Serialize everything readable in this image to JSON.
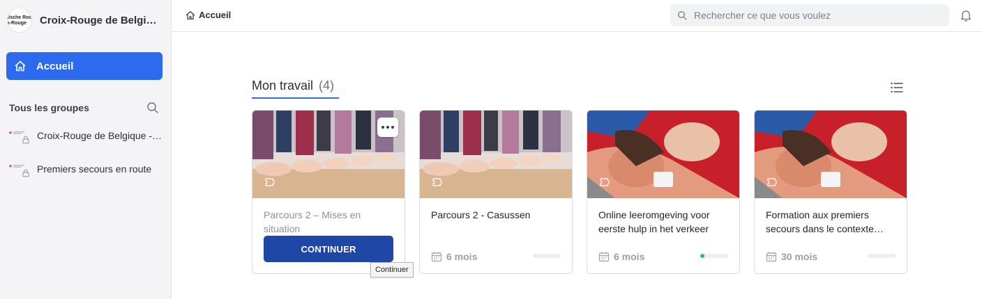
{
  "sidebar": {
    "brand": {
      "name": "Croix-Rouge de Belgique Communauté francophone",
      "logo_lines": [
        "gische Rod",
        "ix-Rouge"
      ]
    },
    "home_label": "Accueil",
    "groups_title": "Tous les groupes",
    "groups": [
      {
        "name": "Croix-Rouge de Belgique - Formations"
      },
      {
        "name": "Premiers secours en route"
      }
    ]
  },
  "topbar": {
    "breadcrumb": "Accueil",
    "search_placeholder": "Rechercher ce que vous voulez"
  },
  "section": {
    "title": "Mon travail",
    "count": "(4)"
  },
  "cards": [
    {
      "title": "Parcours 2 – Mises en situation",
      "duration": "",
      "progress": 0,
      "action_label": "CONTINUER",
      "tooltip": "Continuer"
    },
    {
      "title": "Parcours 2 - Casussen",
      "duration": "6 mois",
      "progress": 0
    },
    {
      "title": "Online leeromgeving voor eerste hulp in het verkeer",
      "duration": "6 mois",
      "progress": 0.05
    },
    {
      "title": "Formation aux premiers secours dans le contexte routier",
      "duration": "30 mois",
      "progress": 0
    }
  ],
  "colors": {
    "accent": "#2c6bed",
    "continue_button": "#1e47a8",
    "progress": "#2fb57c"
  },
  "icons": [
    "home-icon",
    "search-icon",
    "bell-icon",
    "list-view-icon",
    "more-icon",
    "calendar-icon",
    "lock-icon",
    "course-type-icon"
  ]
}
